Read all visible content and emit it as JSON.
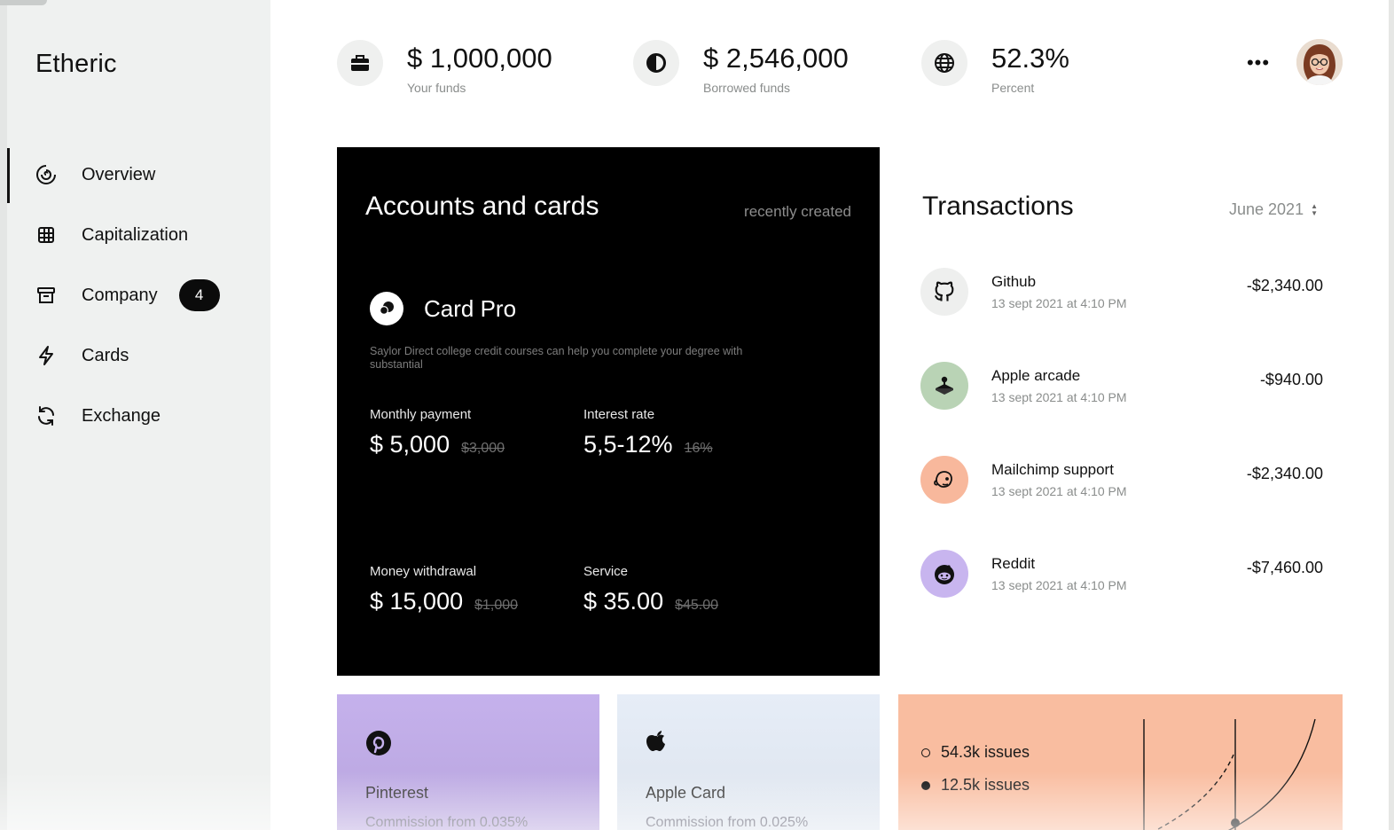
{
  "app": {
    "brand": "Etheric"
  },
  "sidebar": {
    "items": [
      {
        "label": "Overview",
        "icon": "spiral-icon",
        "active": true
      },
      {
        "label": "Capitalization",
        "icon": "grid-chip-icon"
      },
      {
        "label": "Company",
        "icon": "archive-box-icon",
        "badge": "4"
      },
      {
        "label": "Cards",
        "icon": "lightning-icon"
      },
      {
        "label": "Exchange",
        "icon": "refresh-icon"
      }
    ]
  },
  "stats": [
    {
      "value": "$ 1,000,000",
      "label": "Your funds",
      "icon": "briefcase-icon"
    },
    {
      "value": "$ 2,546,000",
      "label": "Borrowed funds",
      "icon": "pie-chart-icon"
    },
    {
      "value": "52.3%",
      "label": "Percent",
      "icon": "globe-icon"
    }
  ],
  "header": {
    "more": "•••",
    "avatar": "user-avatar"
  },
  "accounts": {
    "title": "Accounts and cards",
    "filter": "recently created",
    "card_name": "Card Pro",
    "description": "Saylor Direct college credit courses can help you complete your degree with substantial",
    "metrics": [
      {
        "label": "Monthly payment",
        "value": "$ 5,000",
        "old": "$3,000"
      },
      {
        "label": "Interest rate",
        "value": "5,5-12%",
        "old": "16%"
      },
      {
        "label": "Money withdrawal",
        "value": "$ 15,000",
        "old": "$1,000"
      },
      {
        "label": "Service",
        "value": "$ 35.00",
        "old": "$45.00"
      }
    ]
  },
  "transactions": {
    "title": "Transactions",
    "month": "June 2021",
    "items": [
      {
        "name": "Github",
        "date": "13 sept 2021 at 4:10 PM",
        "amount": "-$2,340.00",
        "icon": "github-icon",
        "color": "#eeefee"
      },
      {
        "name": "Apple arcade",
        "date": "13 sept 2021 at 4:10 PM",
        "amount": "-$940.00",
        "icon": "arcade-joystick-icon",
        "color": "#b9d3b5"
      },
      {
        "name": "Mailchimp support",
        "date": "13 sept 2021 at 4:10 PM",
        "amount": "-$2,340.00",
        "icon": "mailchimp-icon",
        "color": "#f8b89c"
      },
      {
        "name": "Reddit",
        "date": "13 sept 2021 at 4:10 PM",
        "amount": "-$7,460.00",
        "icon": "reddit-icon",
        "color": "#c8b5ef"
      }
    ]
  },
  "tiles": [
    {
      "name": "Pinterest",
      "commission": "Commission from 0.035%",
      "icon": "pinterest-icon",
      "color": "#c5b1ec"
    },
    {
      "name": "Apple Card",
      "commission": "Commission from 0.025%",
      "icon": "apple-icon",
      "color": "#e6edf7"
    }
  ],
  "issues": {
    "legend": [
      {
        "label": "54.3k issues",
        "style": "open"
      },
      {
        "label": "12.5k issues",
        "style": "filled"
      }
    ],
    "color": "#f9bda0"
  }
}
